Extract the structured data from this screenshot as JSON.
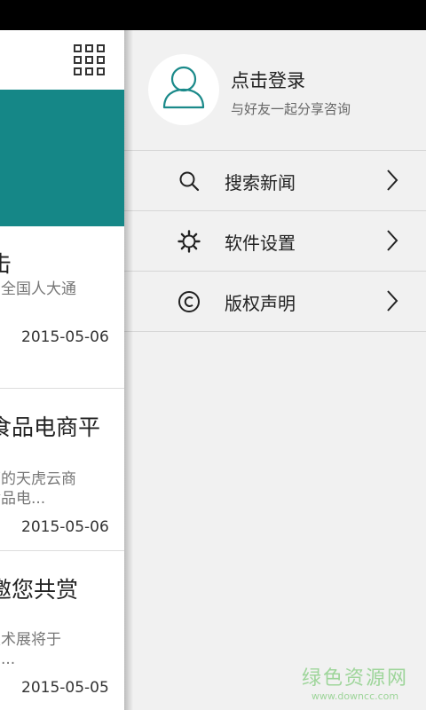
{
  "content": {
    "news": [
      {
        "title": "击",
        "desc": [
          "东全国人大通",
          "..."
        ],
        "date": "2015-05-06"
      },
      {
        "title": "食品电商平",
        "desc": [
          "下的天虎云商",
          "食品电..."
        ],
        "date": "2015-05-06"
      },
      {
        "title": "邀您共赏",
        "desc": [
          "技术展将于",
          "如..."
        ],
        "date": "2015-05-05"
      }
    ]
  },
  "drawer": {
    "login": {
      "title": "点击登录",
      "subtitle": "与好友一起分享咨询"
    },
    "menu": [
      {
        "label": "搜索新闻",
        "icon": "search-icon"
      },
      {
        "label": "软件设置",
        "icon": "gear-icon"
      },
      {
        "label": "版权声明",
        "icon": "copyright-icon"
      }
    ]
  },
  "watermark": {
    "main": "绿色资源网",
    "sub": "www.downcc.com"
  },
  "colors": {
    "accent": "#158787",
    "drawer_bg": "#f1f1f1",
    "avatar_stroke": "#1b8a8a",
    "watermark": "#9ed59a"
  }
}
